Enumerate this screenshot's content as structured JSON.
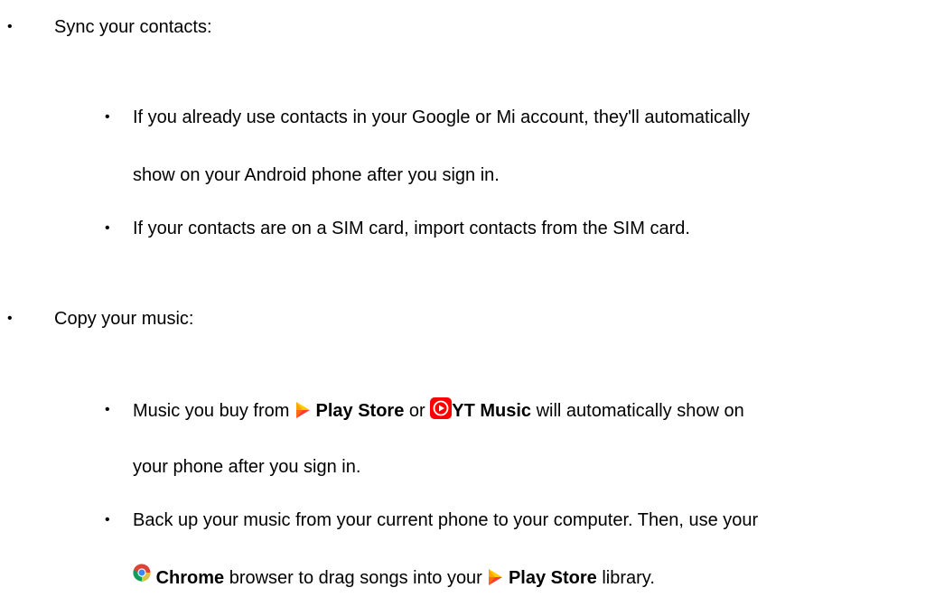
{
  "sections": [
    {
      "heading": "Sync your contacts:",
      "items": [
        {
          "line1": "If you already use contacts in your Google or Mi account, they'll automatically",
          "line2": "show on your Android phone after you sign in."
        },
        {
          "line1": "If your contacts are on a SIM card, import contacts from the SIM card."
        }
      ]
    },
    {
      "heading": "Copy your music:",
      "items": [
        {
          "p1": "Music you buy from ",
          "app1": "Play Store",
          "p2": " or ",
          "app2": "YT Music",
          "p3": " will automatically show on",
          "line2": "your phone after you sign in."
        },
        {
          "line1": "Back up your music from your current phone to your computer. Then, use your",
          "app1": "Chrome",
          "p2": " browser to drag songs into your ",
          "app2": "Play Store",
          "p3": " library."
        }
      ]
    }
  ],
  "bullet_glyph": "•",
  "icons": {
    "play_store": "play-store-icon",
    "yt_music": "yt-music-icon",
    "chrome": "chrome-icon"
  },
  "colors": {
    "text": "#000000",
    "yt_music_red": "#ff0000",
    "play_triangle_top": "#ffcc00",
    "play_triangle_bottom": "#ff3b30"
  }
}
